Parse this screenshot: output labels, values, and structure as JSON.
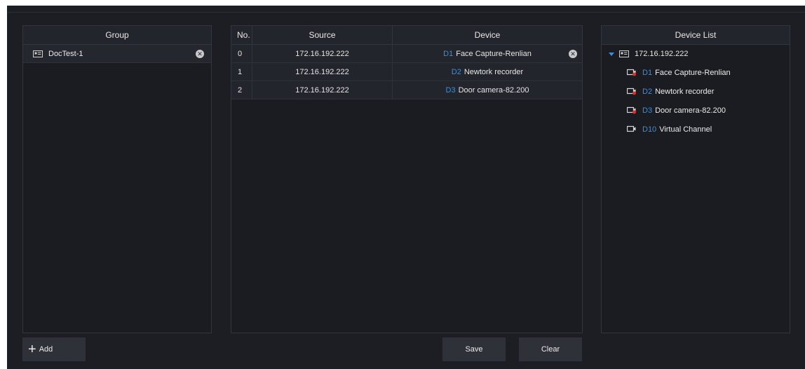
{
  "group_panel": {
    "header": "Group",
    "groups": [
      {
        "name": "DocTest-1",
        "icon": "group-icon"
      }
    ]
  },
  "channel_table": {
    "headers": {
      "no": "No.",
      "source": "Source",
      "device": "Device"
    },
    "rows": [
      {
        "no": "0",
        "source": "172.16.192.222",
        "channel": "D1",
        "device": "Face Capture-Renlian"
      },
      {
        "no": "1",
        "source": "172.16.192.222",
        "channel": "D2",
        "device": "Newtork recorder"
      },
      {
        "no": "2",
        "source": "172.16.192.222",
        "channel": "D3",
        "device": "Door camera-82.200"
      }
    ]
  },
  "device_list": {
    "header": "Device List",
    "root": "172.16.192.222",
    "children": [
      {
        "channel": "D1",
        "name": "Face Capture-Renlian",
        "status": "red"
      },
      {
        "channel": "D2",
        "name": "Newtork recorder",
        "status": "red"
      },
      {
        "channel": "D3",
        "name": "Door camera-82.200",
        "status": "red"
      },
      {
        "channel": "D10",
        "name": "Virtual Channel",
        "status": "none"
      }
    ]
  },
  "buttons": {
    "add": "Add",
    "save": "Save",
    "clear": "Clear"
  },
  "colors": {
    "accent": "#3d8fd6",
    "background": "#1d1e24",
    "alert": "#e0312e"
  }
}
